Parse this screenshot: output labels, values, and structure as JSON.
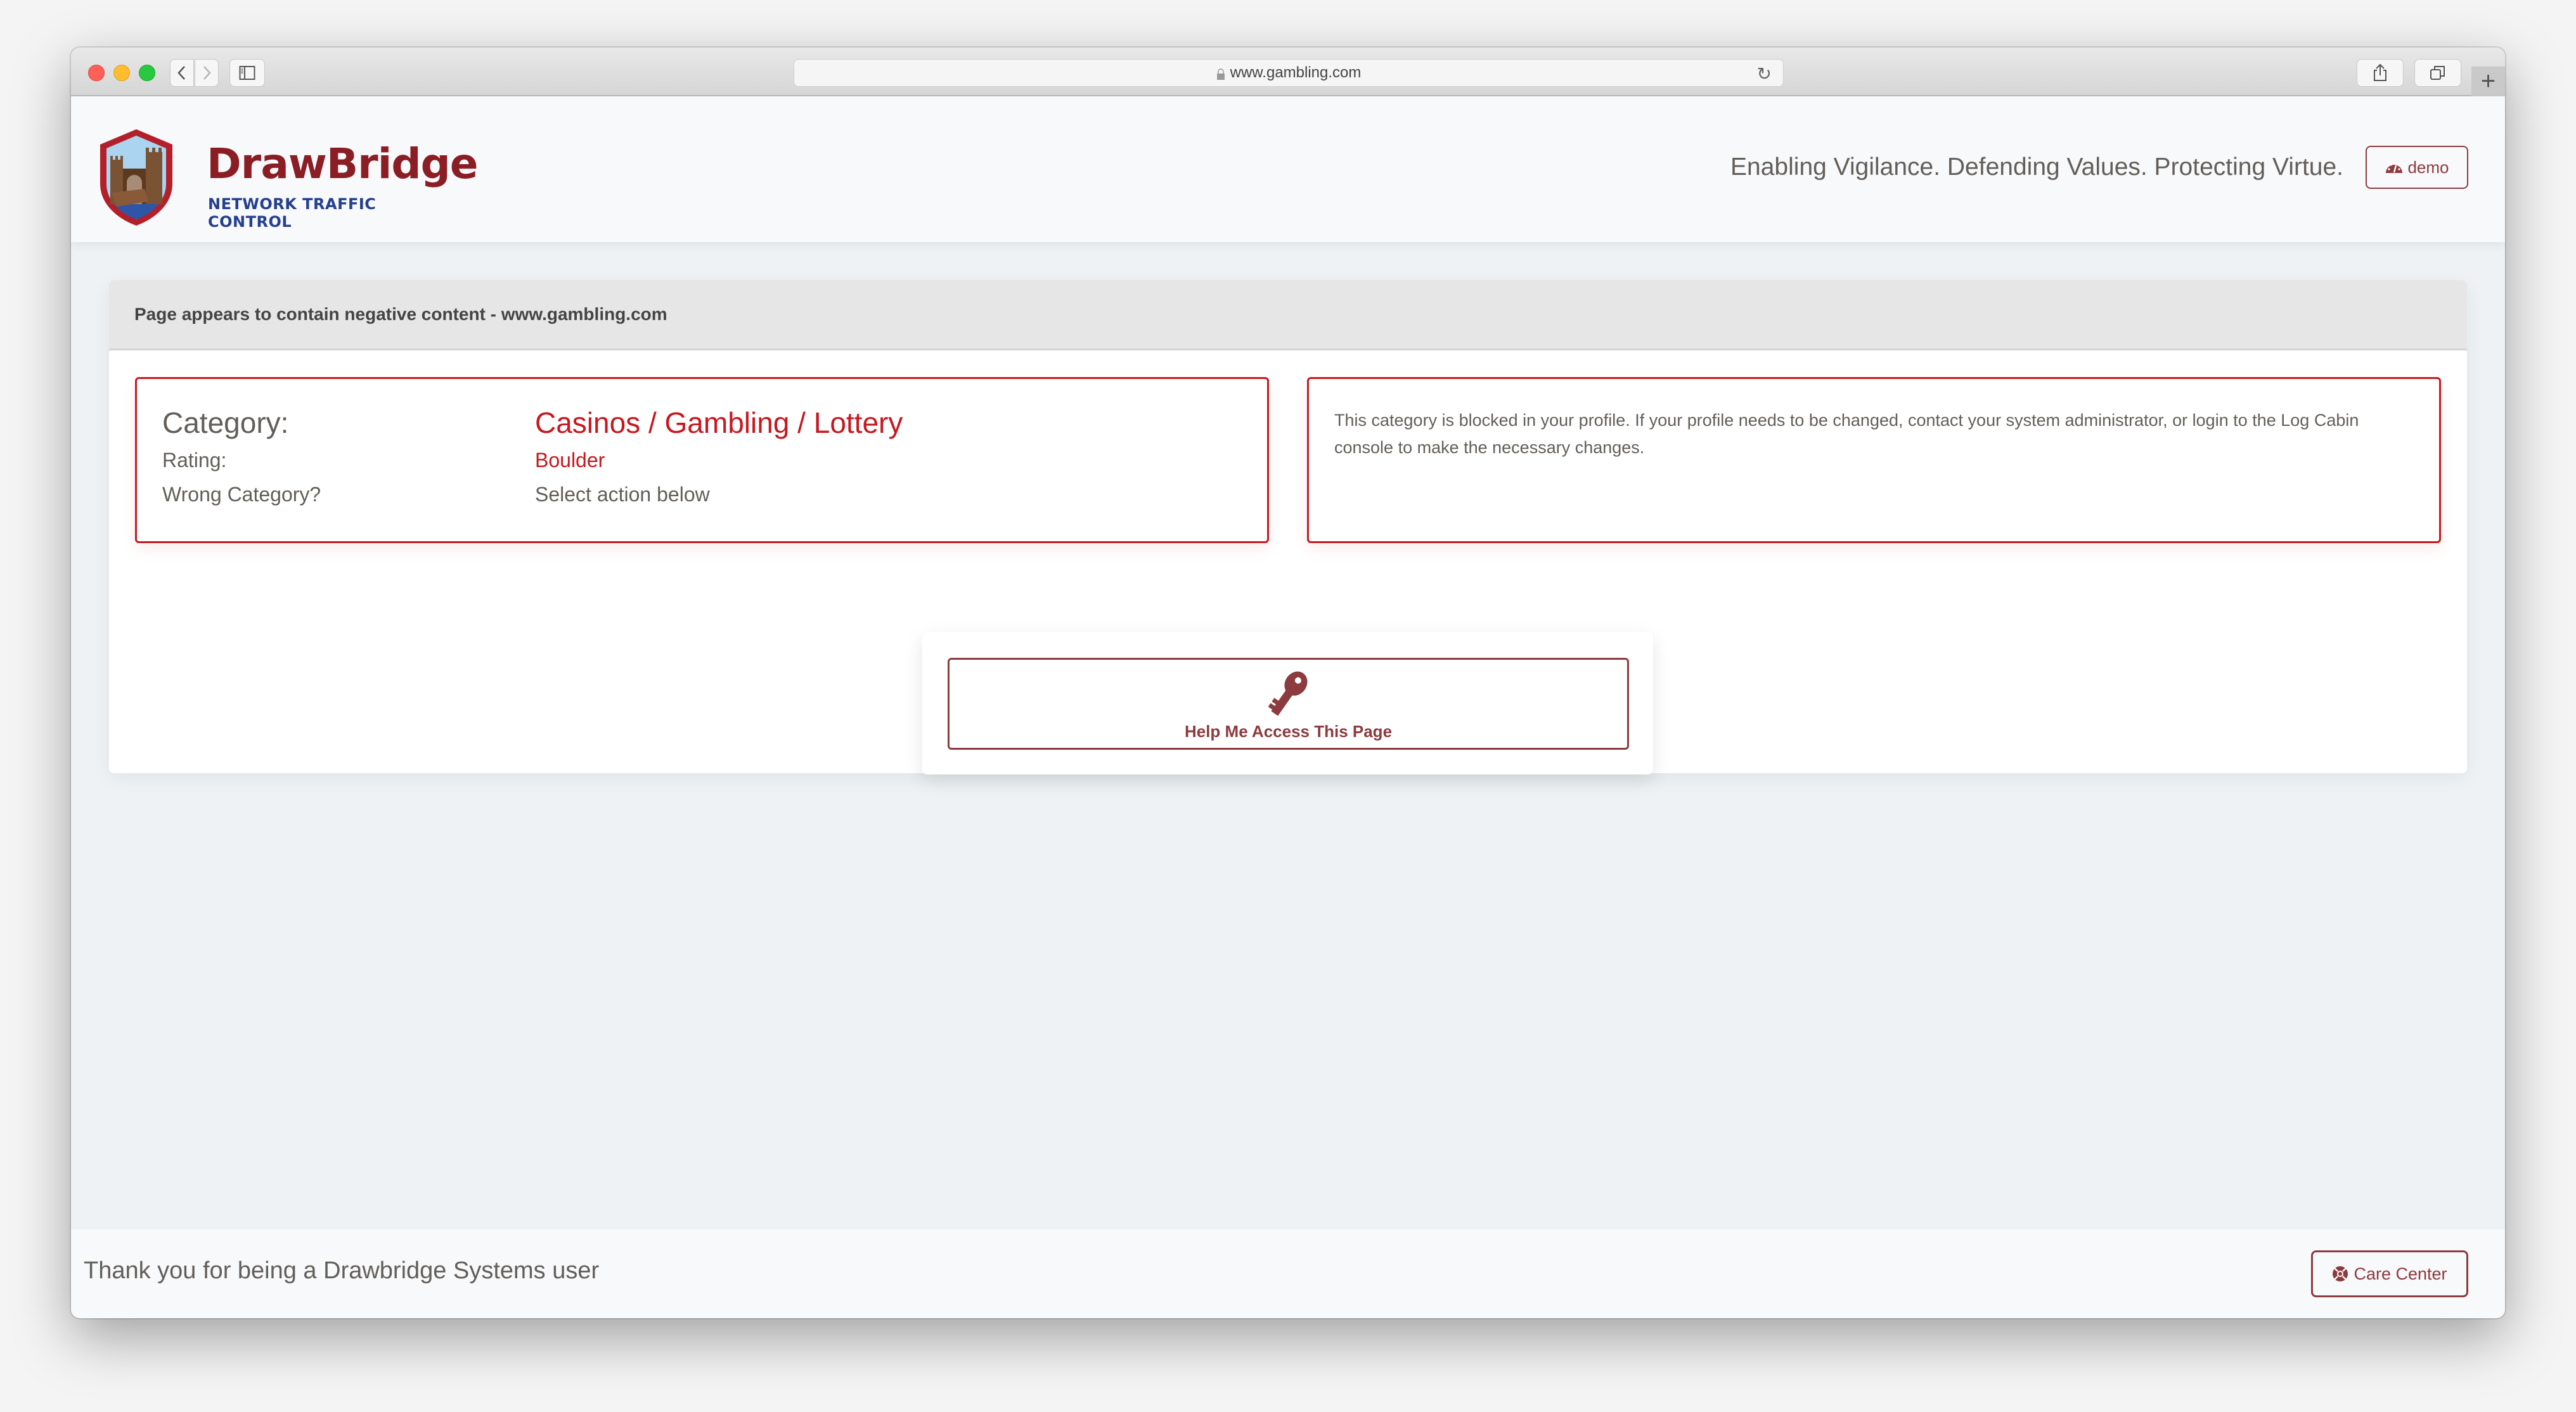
{
  "browser": {
    "url": "www.gambling.com",
    "icons": {
      "back": "chevron-left-icon",
      "forward": "chevron-right-icon",
      "sidebar": "sidebar-icon",
      "lock": "lock-icon",
      "reload": "reload-icon",
      "share": "share-icon",
      "tabs": "tabs-overview-icon",
      "new_tab": "plus-icon"
    }
  },
  "header": {
    "logo_title": "DrawBridge",
    "logo_subtitle": "NETWORK TRAFFIC CONTROL",
    "tagline": "Enabling Vigilance. Defending Values. Protecting Virtue.",
    "demo_button": {
      "label": "demo",
      "icon": "tachometer-icon"
    }
  },
  "card": {
    "title": "Page appears to contain negative content - www.gambling.com",
    "details": {
      "category_label": "Category:",
      "category_value": "Casinos / Gambling / Lottery",
      "rating_label": "Rating:",
      "rating_value": "Boulder",
      "wrong_label": "Wrong Category?",
      "wrong_value": "Select action below"
    },
    "message": "This category is blocked in your profile. If your profile needs to be changed, contact your system administrator, or login to the Log Cabin console to make the necessary changes.",
    "help_button": {
      "label": "Help Me Access This Page",
      "icon": "key-icon"
    }
  },
  "footer": {
    "text": "Thank you for being a Drawbridge Systems user",
    "care_button": {
      "label": "Care Center",
      "icon": "life-ring-icon"
    }
  },
  "colors": {
    "brand_dark_red": "#8c3b3f",
    "alert_red": "#c8171e",
    "logo_red": "#8b1d24",
    "logo_blue": "#24408e",
    "text_gray": "#625e59",
    "page_bg": "#eef2f5"
  }
}
